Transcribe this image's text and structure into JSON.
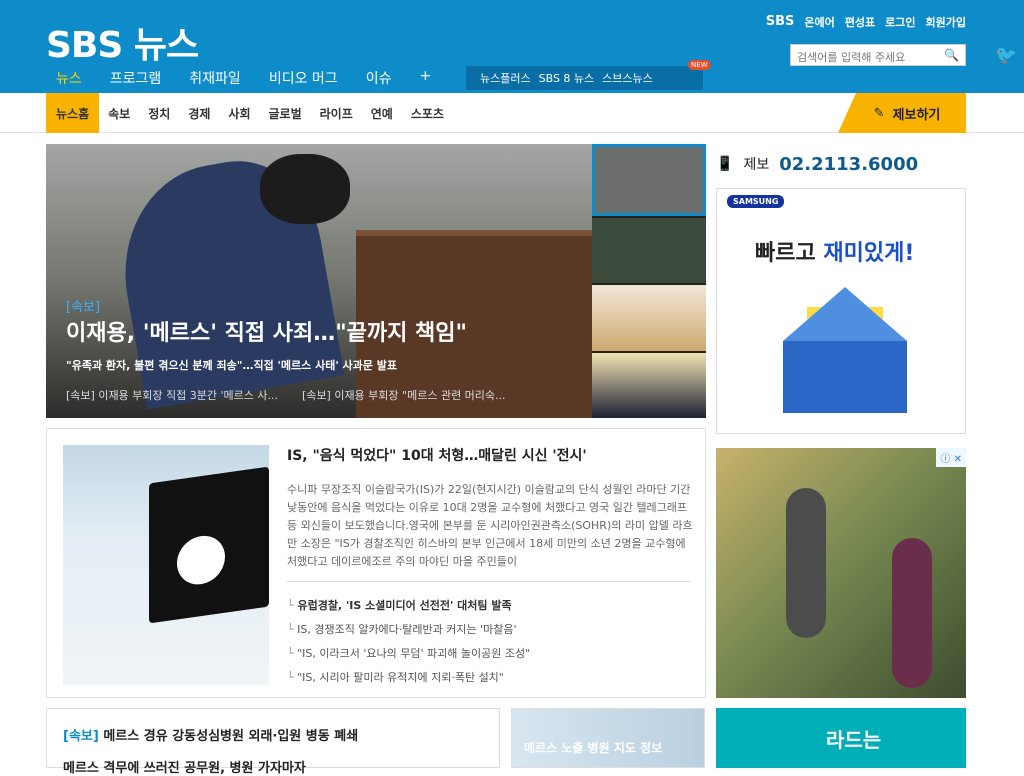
{
  "header": {
    "logo": "SBS 뉴스",
    "util": [
      "SBS",
      "온에어",
      "편성표",
      "로그인",
      "회원가입"
    ],
    "search_placeholder": "검색어를 입력해 주세요",
    "mainnav": [
      "뉴스",
      "프로그램",
      "취재파일",
      "비디오 머그",
      "이슈",
      "+"
    ],
    "subnav": [
      "뉴스플러스",
      "SBS 8 뉴스",
      "스브스뉴스"
    ],
    "subnav_badge": "NEW"
  },
  "catbar": {
    "items": [
      "뉴스홈",
      "속보",
      "정치",
      "경제",
      "사회",
      "글로벌",
      "라이프",
      "연예",
      "스포츠"
    ],
    "report": "제보하기"
  },
  "hero": {
    "tag": "[속보]",
    "title": "이재용, '메르스' 직접 사죄…\"끝까지 책임\"",
    "subtitle": "\"유족과 환자, 불편 겪으신 분께 죄송\"…직접 '메르스 사태' 사과문 발표",
    "links": [
      "[속보] 이재용 부회장 직접 3분간 '메르스 사...",
      "[속보] 이재용 부회장 \"메르스 관련 머리숙..."
    ]
  },
  "article": {
    "title": "IS, \"음식 먹었다\" 10대 처형…매달린 시신 '전시'",
    "body": "수니파 무장조직 이슬람국가(IS)가 22일(현지시간) 이슬람교의 단식 성월인 라마단 기간 낮동안에 음식을 먹었다는 이유로 10대 2명을 교수형에 처했다고 영국 일간 텔레그래프 등 외신들이 보도했습니다.영국에 본부를 둔 시리아인권관측소(SOHR)의 라미 압델 라흐만 소장은 \"IS가 경찰조직인 히스바의 본부 인근에서 18세 미만의 소년 2명을 교수형에 처했다고 데이르에조르 주의 마야딘 마을 주민들이",
    "related": [
      "유럽경찰, 'IS 소셜미디어 선전전' 대처팀 발족",
      "IS, 경쟁조직 알카에다·탈레반과 커지는 '마찰음'",
      "\"IS, 이라크서 '요나의 무덤' 파괴해 놀이공원 조성\"",
      "\"IS, 시리아 팔미라 유적지에 지뢰·폭탄 설치\""
    ]
  },
  "right": {
    "phone_label": "제보",
    "phone_number": "02.2113.6000",
    "ad1_brand": "SAMSUNG",
    "ad1_text1": "빠르고",
    "ad1_text2": "재미있게!",
    "ad_choice": "ⓘ ✕"
  },
  "bottom": {
    "tag": "[속보]",
    "line1": "메르스 경유 강동성심병원 외래·입원 병동 폐쇄",
    "line2": "메르스 격무에 쓰러진 공무원, 병원 가자마자",
    "map_text": "메르스 노출 병원 지도 정보",
    "ad3_text": "라드는"
  }
}
